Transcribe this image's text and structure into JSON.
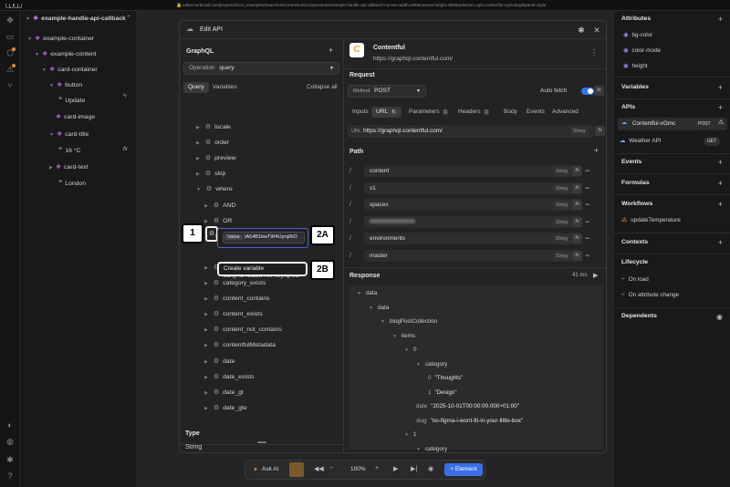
{
  "browser": {
    "url": "editor.nordcraft.com/projects/docs_examples/branches/screenshots/components/example-handle-api-callback?canvas-width=800&canvas-height=800&selection=apis.contentful-vgmc&rightpanel=style"
  },
  "component": {
    "title": "example-handle-api-callback"
  },
  "tree": [
    {
      "label": "example-container",
      "type": "div",
      "depth": 0
    },
    {
      "label": "example-content",
      "type": "div",
      "depth": 1
    },
    {
      "label": "card-container",
      "type": "div",
      "depth": 2
    },
    {
      "label": "button",
      "type": "div",
      "depth": 3
    },
    {
      "label": "Update",
      "type": "text",
      "depth": 4
    },
    {
      "label": "card-image",
      "type": "div",
      "depth": 3
    },
    {
      "label": "card-title",
      "type": "div",
      "depth": 3
    },
    {
      "label": "16 °C",
      "type": "text",
      "depth": 4
    },
    {
      "label": "card-text",
      "type": "div",
      "depth": 3
    },
    {
      "label": "London",
      "type": "text",
      "depth": 4
    }
  ],
  "modal": {
    "title": "Edit API",
    "graphql_label": "GraphQL",
    "operation_label": "Operation",
    "operation_value": "query",
    "tabs": [
      "Query",
      "Variables"
    ],
    "collapse_all": "Collapse all",
    "fields": [
      "locale",
      "order",
      "preview",
      "skip",
      "where",
      "AND",
      "OR",
      "authors",
      "bDQA54B1bwTW4UyrqRiO",
      "category_contains_some",
      "category_exists",
      "content_contains",
      "content_exists",
      "content_not_contains",
      "contentfulMetadata",
      "date",
      "date_exists",
      "date_gt",
      "date_gte"
    ],
    "value_label": "Value",
    "value_text": "bDQA54B1bwTW4UyrqRiO",
    "value_text_visible": ")A54B1bwTW4UyrqRiO",
    "create_variable": "Create variable",
    "type_label": "Type",
    "type_value": "String",
    "service": {
      "name": "Contentful",
      "url": "https://graphql.contentful.com/"
    },
    "request_label": "Request",
    "method_label": "Method",
    "method_value": "POST",
    "autofetch_label": "Auto fetch",
    "req_tabs": [
      {
        "label": "Inputs"
      },
      {
        "label": "URL",
        "count": "6"
      },
      {
        "label": "Parameters",
        "count": "1"
      },
      {
        "label": "Headers",
        "count": "1"
      },
      {
        "label": "Body"
      },
      {
        "label": "Events"
      },
      {
        "label": "Advanced"
      }
    ],
    "url_label": "URL",
    "url_value": "https://graphql.contentful.com/",
    "string_tag": "String",
    "path_label": "Path",
    "path": [
      "content",
      "v1",
      "spaces",
      "",
      "environments",
      "master"
    ],
    "response_label": "Response",
    "response_time": "41 ms",
    "response_tree": [
      {
        "k": "data",
        "d": 0
      },
      {
        "k": "data",
        "d": 1
      },
      {
        "k": "blogPostCollection",
        "d": 2
      },
      {
        "k": "items",
        "d": 3
      },
      {
        "k": "0",
        "d": 4
      },
      {
        "k": "category",
        "d": 5
      },
      {
        "k": "0",
        "v": "\"Thoughts\"",
        "d": 6
      },
      {
        "k": "1",
        "v": "\"Design\"",
        "d": 6
      },
      {
        "k": "date",
        "v": "\"2025-10-01T00:00:00.000+01:00\"",
        "d": 5
      },
      {
        "k": "slug",
        "v": "\"no-figma-i-wont-fit-in-your-little-box\"",
        "d": 5
      },
      {
        "k": "1",
        "d": 4
      },
      {
        "k": "category",
        "d": 5
      }
    ]
  },
  "callouts": {
    "c1": "1",
    "c2a": "2A",
    "c2b": "2B"
  },
  "sidebar": {
    "attributes": "Attributes",
    "attr_items": [
      "bg-color",
      "color-mode",
      "height"
    ],
    "variables": "Variables",
    "apis": "APIs",
    "api_items": [
      {
        "name": "Contentful-vGmc",
        "method": "POST"
      },
      {
        "name": "Weather API",
        "method": "GET"
      }
    ],
    "events": "Events",
    "formulas": "Formulas",
    "workflows": "Workflows",
    "workflow_items": [
      "updateTemperature"
    ],
    "contexts": "Contexts",
    "lifecycle": "Lifecycle",
    "lifecycle_items": [
      "On load",
      "On attribute change"
    ],
    "dependents": "Dependents"
  },
  "bottombar": {
    "ask_ai": "Ask AI",
    "zoom": "100%",
    "add_element": "Element"
  }
}
